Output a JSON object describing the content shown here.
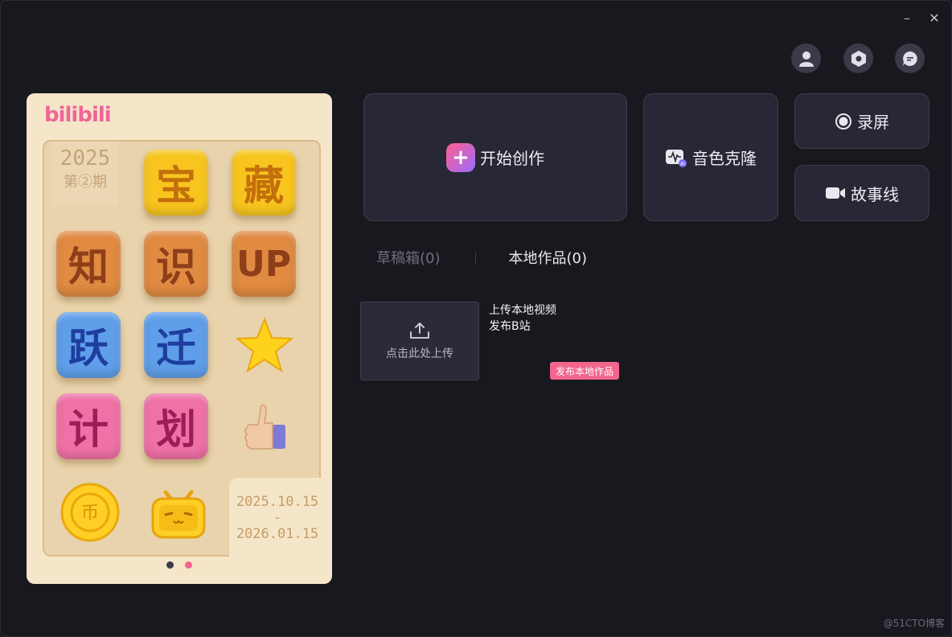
{
  "window": {
    "minimize": "–",
    "close": "✕"
  },
  "top_icons": [
    "user-icon",
    "settings-hex-icon",
    "chat-icon"
  ],
  "banner": {
    "logo": "bilibili",
    "issue_year": "2025",
    "issue_no": "第②期",
    "tiles": [
      "宝",
      "藏",
      "知",
      "识",
      "UP",
      "跃",
      "迁",
      "计",
      "划"
    ],
    "date_start": "2025.10.15",
    "date_dash": "-",
    "date_end": "2026.01.15",
    "page_indicator": {
      "count": 2,
      "active": 2
    }
  },
  "actions": {
    "start_create": "开始创作",
    "voice_clone": "音色克隆",
    "voice_clone_badge": "AI",
    "record_screen": "录屏",
    "storyline": "故事线"
  },
  "tabs": [
    {
      "label": "草稿箱(0)",
      "active": false
    },
    {
      "label": "本地作品(0)",
      "active": true
    }
  ],
  "upload": {
    "label": "点击此处上传"
  },
  "info": {
    "line1": "上传本地视频",
    "line2": "发布B站"
  },
  "publish_button": "发布本地作品",
  "watermark": "@51CTO博客",
  "colors": {
    "accent_pink": "#f2658e",
    "card_bg": "#272735",
    "bg": "#18181f"
  }
}
